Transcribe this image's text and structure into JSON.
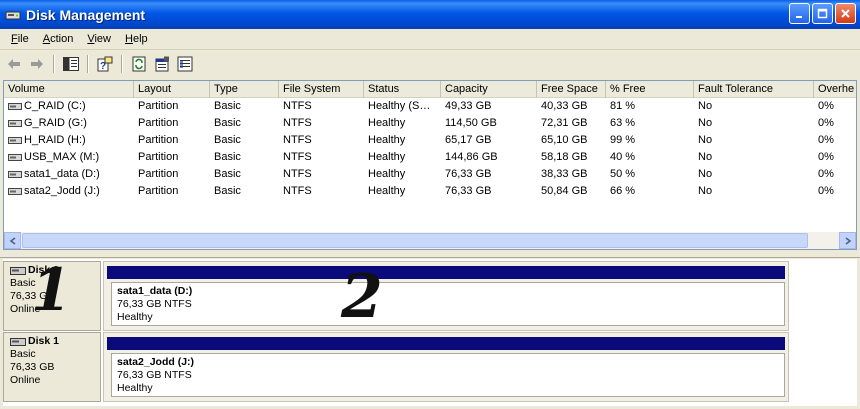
{
  "window": {
    "title": "Disk Management"
  },
  "menu": [
    "File",
    "Action",
    "View",
    "Help"
  ],
  "toolbar": {
    "icons": [
      "back-arrow-icon",
      "forward-arrow-icon",
      "show-hide-console-tree-icon",
      "help-icon",
      "refresh-icon",
      "properties-icon",
      "export-list-icon"
    ]
  },
  "volumes": {
    "columns": [
      "Volume",
      "Layout",
      "Type",
      "File System",
      "Status",
      "Capacity",
      "Free Space",
      "% Free",
      "Fault Tolerance",
      "Overhe"
    ],
    "rows": [
      [
        "C_RAID (C:)",
        "Partition",
        "Basic",
        "NTFS",
        "Healthy (S…",
        "49,33 GB",
        "40,33 GB",
        "81 %",
        "No",
        "0%"
      ],
      [
        "G_RAID (G:)",
        "Partition",
        "Basic",
        "NTFS",
        "Healthy",
        "114,50 GB",
        "72,31 GB",
        "63 %",
        "No",
        "0%"
      ],
      [
        "H_RAID (H:)",
        "Partition",
        "Basic",
        "NTFS",
        "Healthy",
        "65,17 GB",
        "65,10 GB",
        "99 %",
        "No",
        "0%"
      ],
      [
        "USB_MAX (M:)",
        "Partition",
        "Basic",
        "NTFS",
        "Healthy",
        "144,86 GB",
        "58,18 GB",
        "40 %",
        "No",
        "0%"
      ],
      [
        "sata1_data (D:)",
        "Partition",
        "Basic",
        "NTFS",
        "Healthy",
        "76,33 GB",
        "38,33 GB",
        "50 %",
        "No",
        "0%"
      ],
      [
        "sata2_Jodd (J:)",
        "Partition",
        "Basic",
        "NTFS",
        "Healthy",
        "76,33 GB",
        "50,84 GB",
        "66 %",
        "No",
        "0%"
      ]
    ]
  },
  "disks": [
    {
      "name": "Disk 0",
      "type": "Basic",
      "size": "76,33 GB",
      "state": "Online",
      "partition": {
        "name": "sata1_data  (D:)",
        "detail": "76,33 GB NTFS",
        "status": "Healthy"
      }
    },
    {
      "name": "Disk 1",
      "type": "Basic",
      "size": "76,33 GB",
      "state": "Online",
      "partition": {
        "name": "sata2_Jodd  (J:)",
        "detail": "76,33 GB NTFS",
        "status": "Healthy"
      }
    }
  ],
  "annotations": {
    "left": "1",
    "right": "2"
  },
  "colors": {
    "titlebar": "#0058e6",
    "partition_bar": "#0a0a7a"
  }
}
